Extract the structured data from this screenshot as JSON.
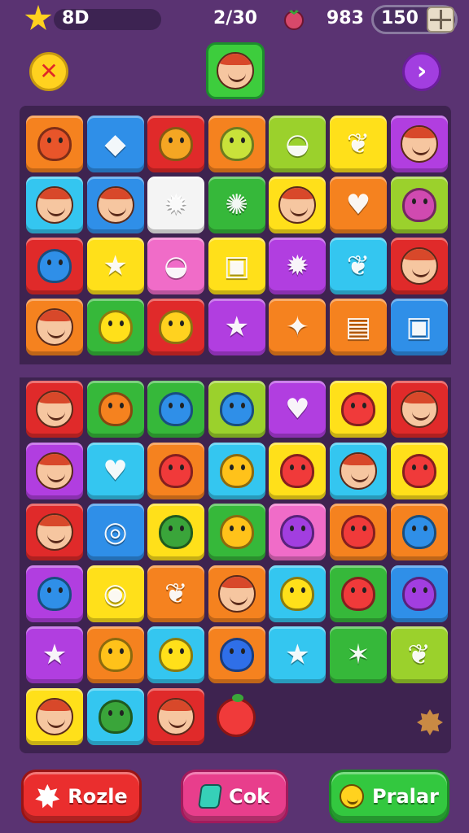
{
  "hud": {
    "score": "8D",
    "moves": "2/30",
    "coins": "983",
    "gems": "150"
  },
  "icons": {
    "star": "star-icon",
    "berry": "berry-icon",
    "box": "box-icon",
    "close": "close-icon",
    "next": "chevron-right-icon",
    "avatar": "avatar-face-icon"
  },
  "glyphs": {
    "close": "✕",
    "next": "›"
  },
  "board": {
    "colors": {
      "orange": "#f5821f",
      "blue": "#2f8fe8",
      "red": "#e02a2a",
      "yellow": "#ffe01a",
      "green": "#36b83a",
      "lime": "#9bd12c",
      "purple": "#b13ee0",
      "pink": "#f06cc8",
      "cyan": "#34c6f0",
      "white": "#f4f4f4"
    },
    "top_rows": [
      [
        "orange",
        "blue",
        "red",
        "orange",
        "lime",
        "yellow",
        "purple"
      ],
      [
        "cyan",
        "blue",
        "white",
        "green",
        "yellow",
        "orange",
        "lime"
      ],
      [
        "red",
        "yellow",
        "pink",
        "yellow",
        "purple",
        "cyan",
        "red"
      ],
      [
        "orange",
        "green",
        "red",
        "purple",
        "orange",
        "orange",
        "blue"
      ]
    ],
    "top_icons": [
      [
        "fruit",
        "ice",
        "carrot",
        "lime",
        "pot",
        "leaf",
        "face"
      ],
      [
        "face",
        "face",
        "sun",
        "gear",
        "face",
        "heart",
        "shirt"
      ],
      [
        "blob",
        "star",
        "pot",
        "box",
        "sun",
        "leaf",
        "face"
      ],
      [
        "face",
        "smile",
        "banana",
        "star",
        "sparkle",
        "book",
        "box"
      ]
    ],
    "bottom_rows": [
      [
        "red",
        "green",
        "green",
        "lime",
        "purple",
        "yellow",
        "red"
      ],
      [
        "purple",
        "cyan",
        "orange",
        "cyan",
        "yellow",
        "cyan",
        "yellow"
      ],
      [
        "red",
        "blue",
        "yellow",
        "green",
        "pink",
        "orange",
        "orange"
      ],
      [
        "purple",
        "yellow",
        "orange",
        "orange",
        "cyan",
        "green",
        "blue"
      ],
      [
        "purple",
        "orange",
        "cyan",
        "orange",
        "cyan",
        "green",
        "lime"
      ],
      [
        "yellow",
        "cyan",
        "red"
      ]
    ],
    "bottom_icons": [
      [
        "face",
        "orange",
        "blob",
        "drop",
        "heart",
        "apple",
        "face"
      ],
      [
        "face",
        "heart",
        "apple",
        "lemon",
        "apple",
        "face",
        "apple"
      ],
      [
        "face",
        "coin",
        "melon",
        "lemon",
        "plum",
        "apple",
        "blob"
      ],
      [
        "blob",
        "candy",
        "leaf",
        "face",
        "smile",
        "apple",
        "plum"
      ],
      [
        "star",
        "lemon",
        "smile",
        "berry",
        "star",
        "spark",
        "leaf"
      ],
      [
        "face",
        "melon",
        "face"
      ]
    ]
  },
  "buttons": {
    "puzzle": "Rozle",
    "cook": "Cok",
    "praise": "Pralar"
  }
}
